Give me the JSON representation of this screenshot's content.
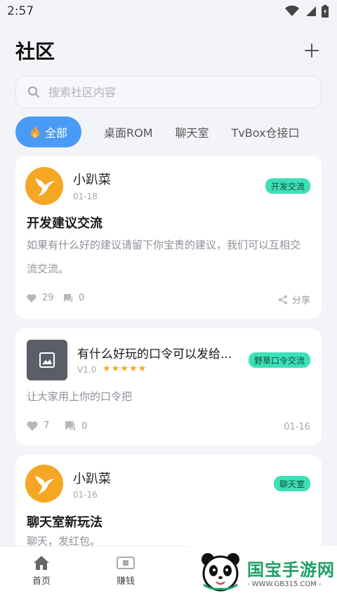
{
  "status_bar": {
    "time": "2:57"
  },
  "header": {
    "title": "社区"
  },
  "search": {
    "placeholder": "搜索社区内容"
  },
  "tabs": [
    {
      "label": "全部",
      "icon": "fire-icon"
    },
    {
      "label": "桌面ROM"
    },
    {
      "label": "聊天室"
    },
    {
      "label": "TvBox仓接口"
    }
  ],
  "posts": [
    {
      "author": "小趴菜",
      "date": "01-18",
      "tag": "开发交流",
      "title": "开发建议交流",
      "body": "如果有什么好的建议请留下你宝贵的建议，我们可以互相交流交流。",
      "likes": "29",
      "comments": "0",
      "share_label": "分享"
    },
    {
      "title": "有什么好玩的口令可以发给...",
      "version": "V1.0",
      "stars": "★★★★★",
      "tag": "野草口令交流",
      "body": "让大家用上你的口令把",
      "likes": "7",
      "comments": "0",
      "date": "01-16"
    },
    {
      "author": "小趴菜",
      "date": "01-16",
      "tag": "聊天室",
      "title": "聊天室新玩法",
      "body": "聊天，发红包。"
    }
  ],
  "bottom_nav": [
    {
      "label": "首页"
    },
    {
      "label": "赚钱"
    }
  ],
  "watermark": {
    "title": "国宝手游网",
    "url": "- WWW.GB315.COM -"
  },
  "colors": {
    "accent": "#4a9bf5",
    "tag": "#3de0b8",
    "avatar": "#f5a623"
  }
}
